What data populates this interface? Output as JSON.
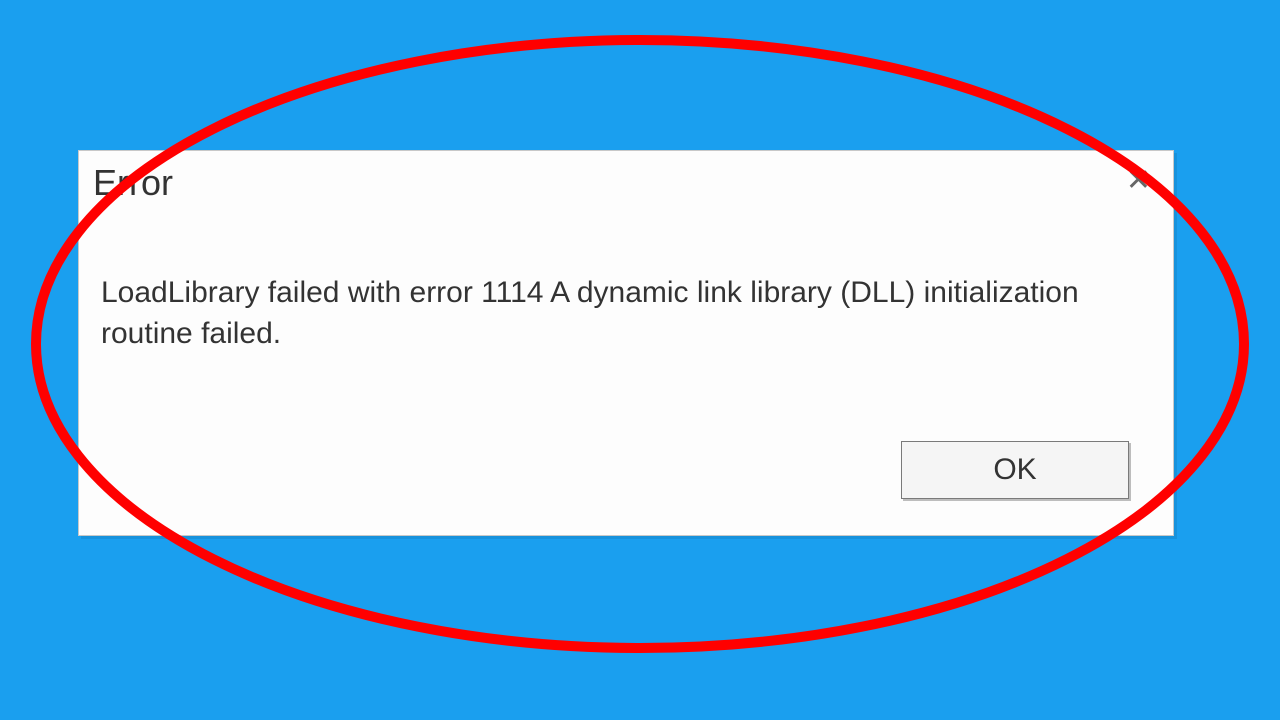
{
  "dialog": {
    "title": "Error",
    "message": "LoadLibrary failed with error 1114 A dynamic link library (DLL) initialization routine failed.",
    "ok_label": "OK"
  },
  "annotation": {
    "ellipse_color": "#ff0000"
  }
}
